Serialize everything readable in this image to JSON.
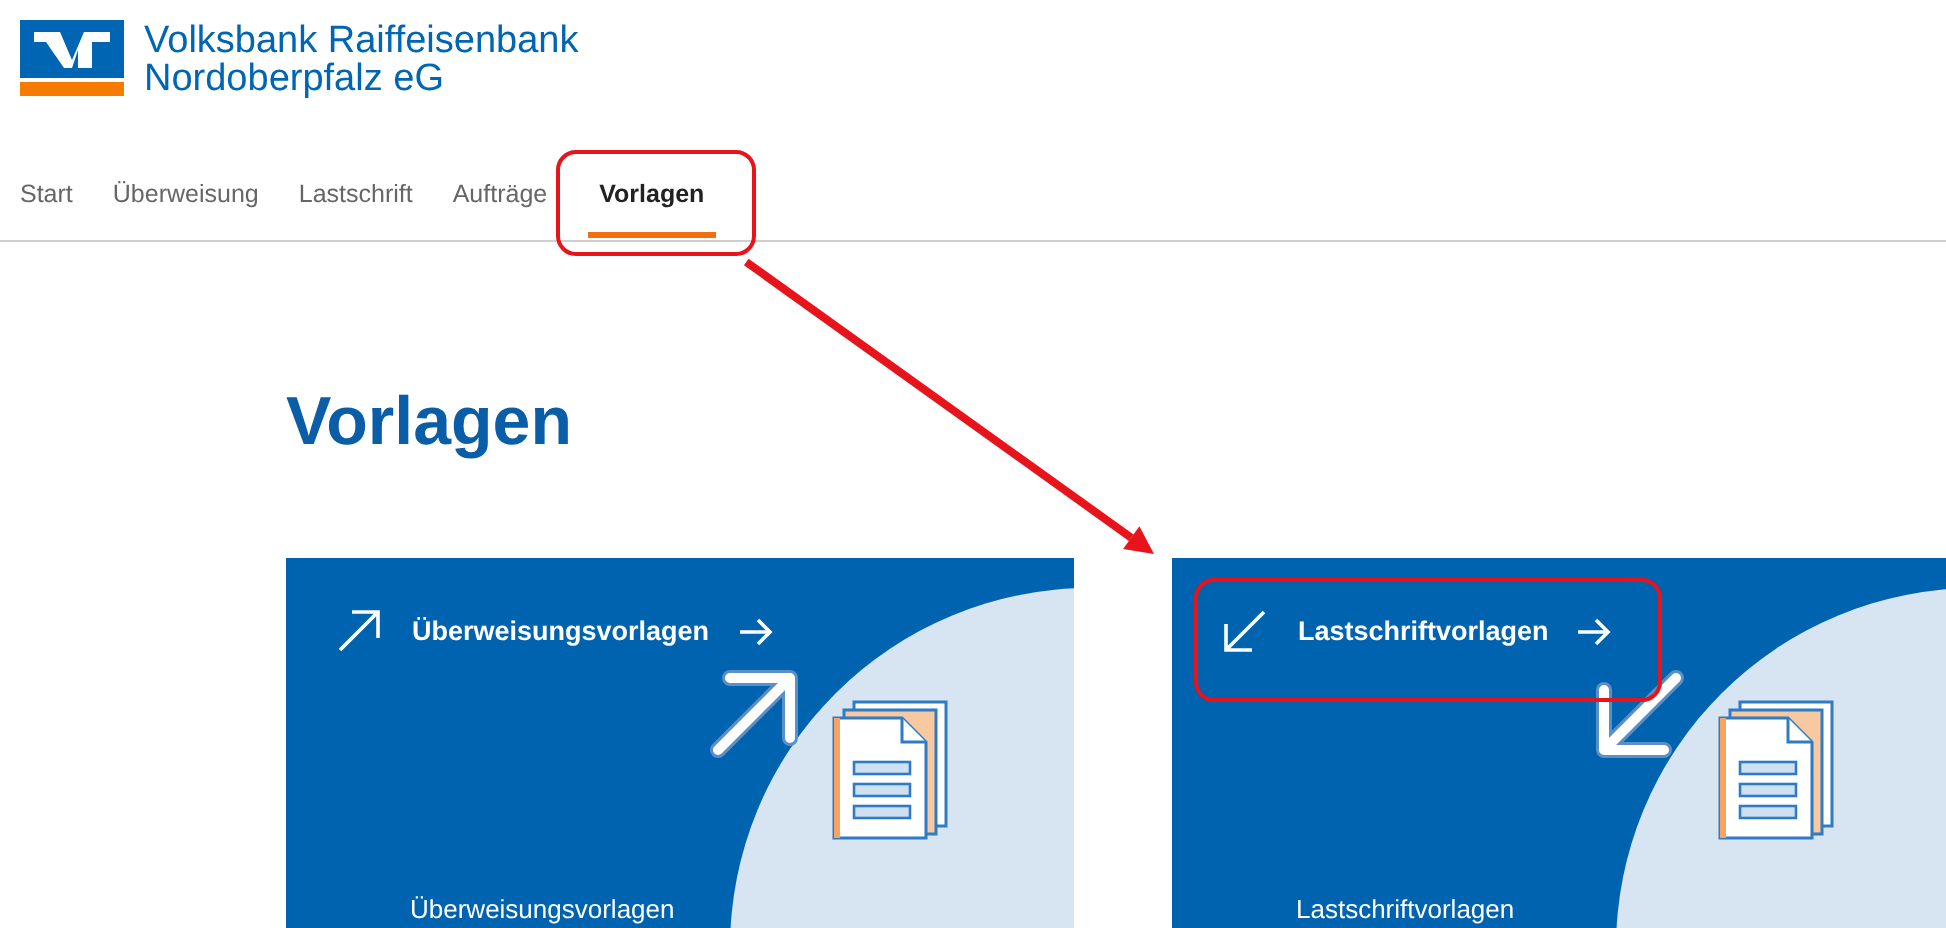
{
  "header": {
    "bank_name_line1": "Volksbank Raiffeisenbank",
    "bank_name_line2": "Nordoberpfalz eG"
  },
  "nav": [
    {
      "label": "Start",
      "selected": false,
      "highlighted": false
    },
    {
      "label": "Überweisung",
      "selected": false,
      "highlighted": false
    },
    {
      "label": "Lastschrift",
      "selected": false,
      "highlighted": false
    },
    {
      "label": "Aufträge",
      "selected": false,
      "highlighted": false
    },
    {
      "label": "Vorlagen",
      "selected": true,
      "highlighted": true
    }
  ],
  "page_title": "Vorlagen",
  "cards": [
    {
      "kind": "transfer",
      "title": "Überweisungsvorlagen",
      "caption": "Überweisungsvorlagen",
      "highlighted": false
    },
    {
      "kind": "direct_debit",
      "title": "Lastschriftvorlagen",
      "caption": "Lastschriftvorlagen",
      "highlighted": true
    }
  ]
}
